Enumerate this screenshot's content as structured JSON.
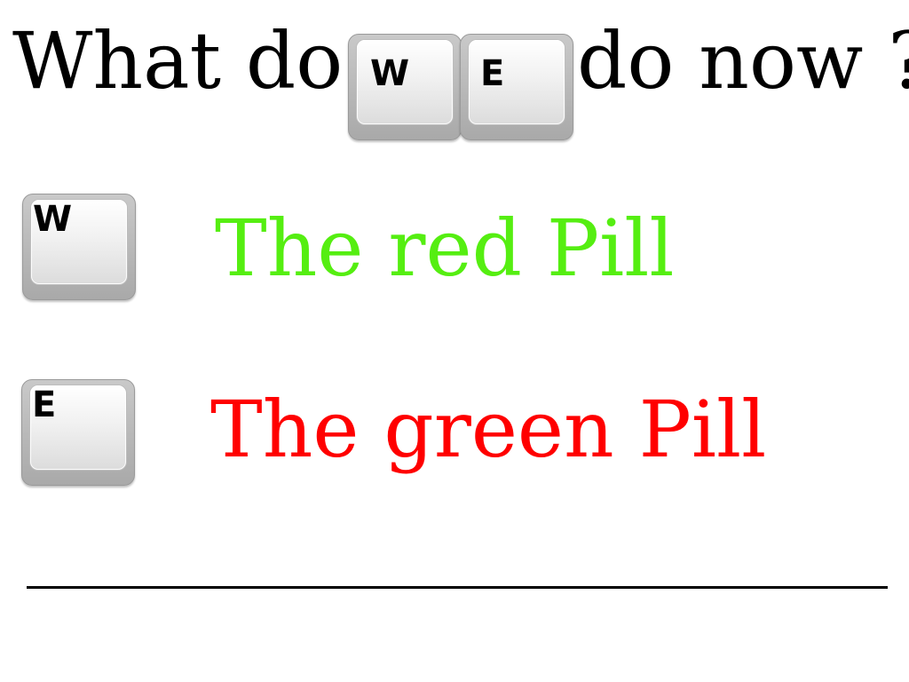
{
  "question": {
    "prefix": "What do",
    "key1": "W",
    "key2": "E",
    "suffix": "do now ?"
  },
  "options": [
    {
      "key": "W",
      "label": "The red Pill",
      "color": "#55ee11"
    },
    {
      "key": "E",
      "label": "The green Pill",
      "color": "#ff0000"
    }
  ]
}
